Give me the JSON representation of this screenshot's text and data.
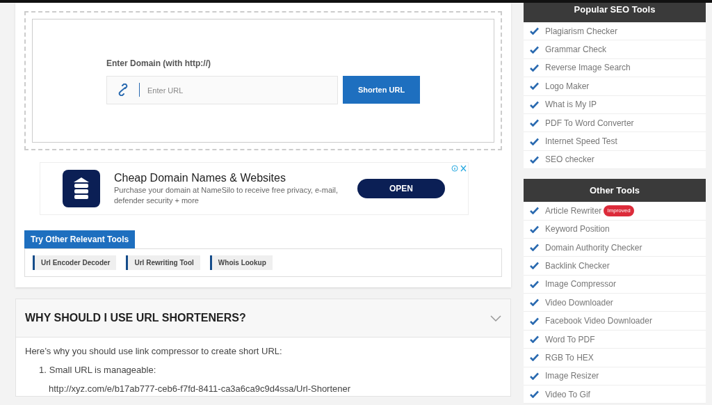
{
  "shortener": {
    "label": "Enter Domain (with http://)",
    "placeholder": "Enter URL",
    "button": "Shorten URL"
  },
  "ad": {
    "title": "Cheap Domain Names & Websites",
    "text": "Purchase your domain at NameSilo to receive free privacy, e-mail, defender security + more",
    "button": "OPEN"
  },
  "related": {
    "title": "Try Other Relevant Tools",
    "links": [
      "Url Encoder Decoder",
      "Url Rewriting Tool",
      "Whois Lookup"
    ]
  },
  "faq": {
    "question": "WHY SHOULD I USE URL SHORTENERS?",
    "expanded": true,
    "intro": "Here’s why you should use link compressor to create short URL:",
    "points": [
      {
        "number": "1.",
        "text": "Small URL is manageable:",
        "example": "http://xyz.com/e/b17ab777-ceb6-f7fd-8411-ca3a6ca9c9d4ssa/Url-Shortener"
      }
    ]
  },
  "sidebar": [
    {
      "title": "Popular SEO Tools",
      "items": [
        {
          "label": "Plagiarism Checker"
        },
        {
          "label": "Grammar Check"
        },
        {
          "label": "Reverse Image Search"
        },
        {
          "label": "Logo Maker"
        },
        {
          "label": "What is My IP"
        },
        {
          "label": "PDF To Word Converter"
        },
        {
          "label": "Internet Speed Test"
        },
        {
          "label": "SEO checker"
        }
      ]
    },
    {
      "title": "Other Tools",
      "items": [
        {
          "label": "Article Rewriter",
          "badge": "Improved"
        },
        {
          "label": "Keyword Position"
        },
        {
          "label": "Domain Authority Checker"
        },
        {
          "label": "Backlink Checker"
        },
        {
          "label": "Image Compressor"
        },
        {
          "label": "Video Downloader"
        },
        {
          "label": "Facebook Video Downloader"
        },
        {
          "label": "Word To PDF"
        },
        {
          "label": "RGB To HEX"
        },
        {
          "label": "Image Resizer"
        },
        {
          "label": "Video To Gif"
        }
      ]
    }
  ]
}
